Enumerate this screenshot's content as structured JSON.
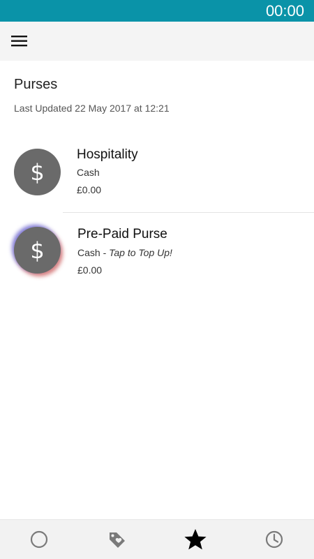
{
  "status_bar": {
    "time": "00:00",
    "color": "#0a93a8"
  },
  "app_bar": {
    "menu_icon": "hamburger-menu-icon"
  },
  "page": {
    "title": "Purses",
    "last_updated": "Last Updated 22 May 2017 at 12:21"
  },
  "purses": [
    {
      "icon": "dollar-icon",
      "symbol": "$",
      "name": "Hospitality",
      "type": "Cash",
      "action": "",
      "balance": "£0.00"
    },
    {
      "icon": "dollar-icon",
      "symbol": "$",
      "name": "Pre-Paid Purse",
      "type": "Cash - ",
      "action": "Tap to Top Up!",
      "balance": "£0.00"
    }
  ],
  "bottom_nav": [
    {
      "icon": "circle-icon",
      "active": false
    },
    {
      "icon": "tag-heart-icon",
      "active": false
    },
    {
      "icon": "star-icon",
      "active": true
    },
    {
      "icon": "clock-icon",
      "active": false
    }
  ],
  "colors": {
    "accent": "#0a93a8",
    "avatar": "#6a6a6a",
    "nav_inactive": "#7a7a7a",
    "nav_active": "#000000"
  }
}
